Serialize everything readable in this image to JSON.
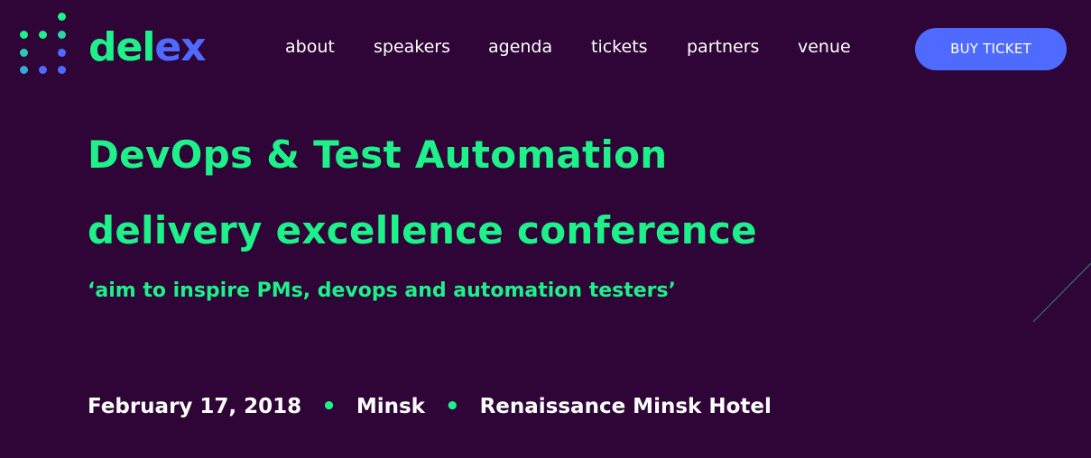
{
  "brand": {
    "logo_text_a": "del",
    "logo_text_b": "ex",
    "color_green": "#1ef08a",
    "color_blue": "#4f6bff",
    "background": "#2e0536"
  },
  "nav": {
    "items": [
      {
        "label": "about"
      },
      {
        "label": "speakers"
      },
      {
        "label": "agenda"
      },
      {
        "label": "tickets"
      },
      {
        "label": "partners"
      },
      {
        "label": "venue"
      }
    ],
    "cta_label": "BUY TICKET"
  },
  "hero": {
    "title_line1": "DevOps & Test Automation",
    "title_line2": "delivery excellence conference",
    "tagline": "‘aim to inspire PMs, devops and automation testers’"
  },
  "event": {
    "date": "February 17, 2018",
    "city": "Minsk",
    "venue": "Renaissance Minsk Hotel",
    "separator": "•"
  }
}
